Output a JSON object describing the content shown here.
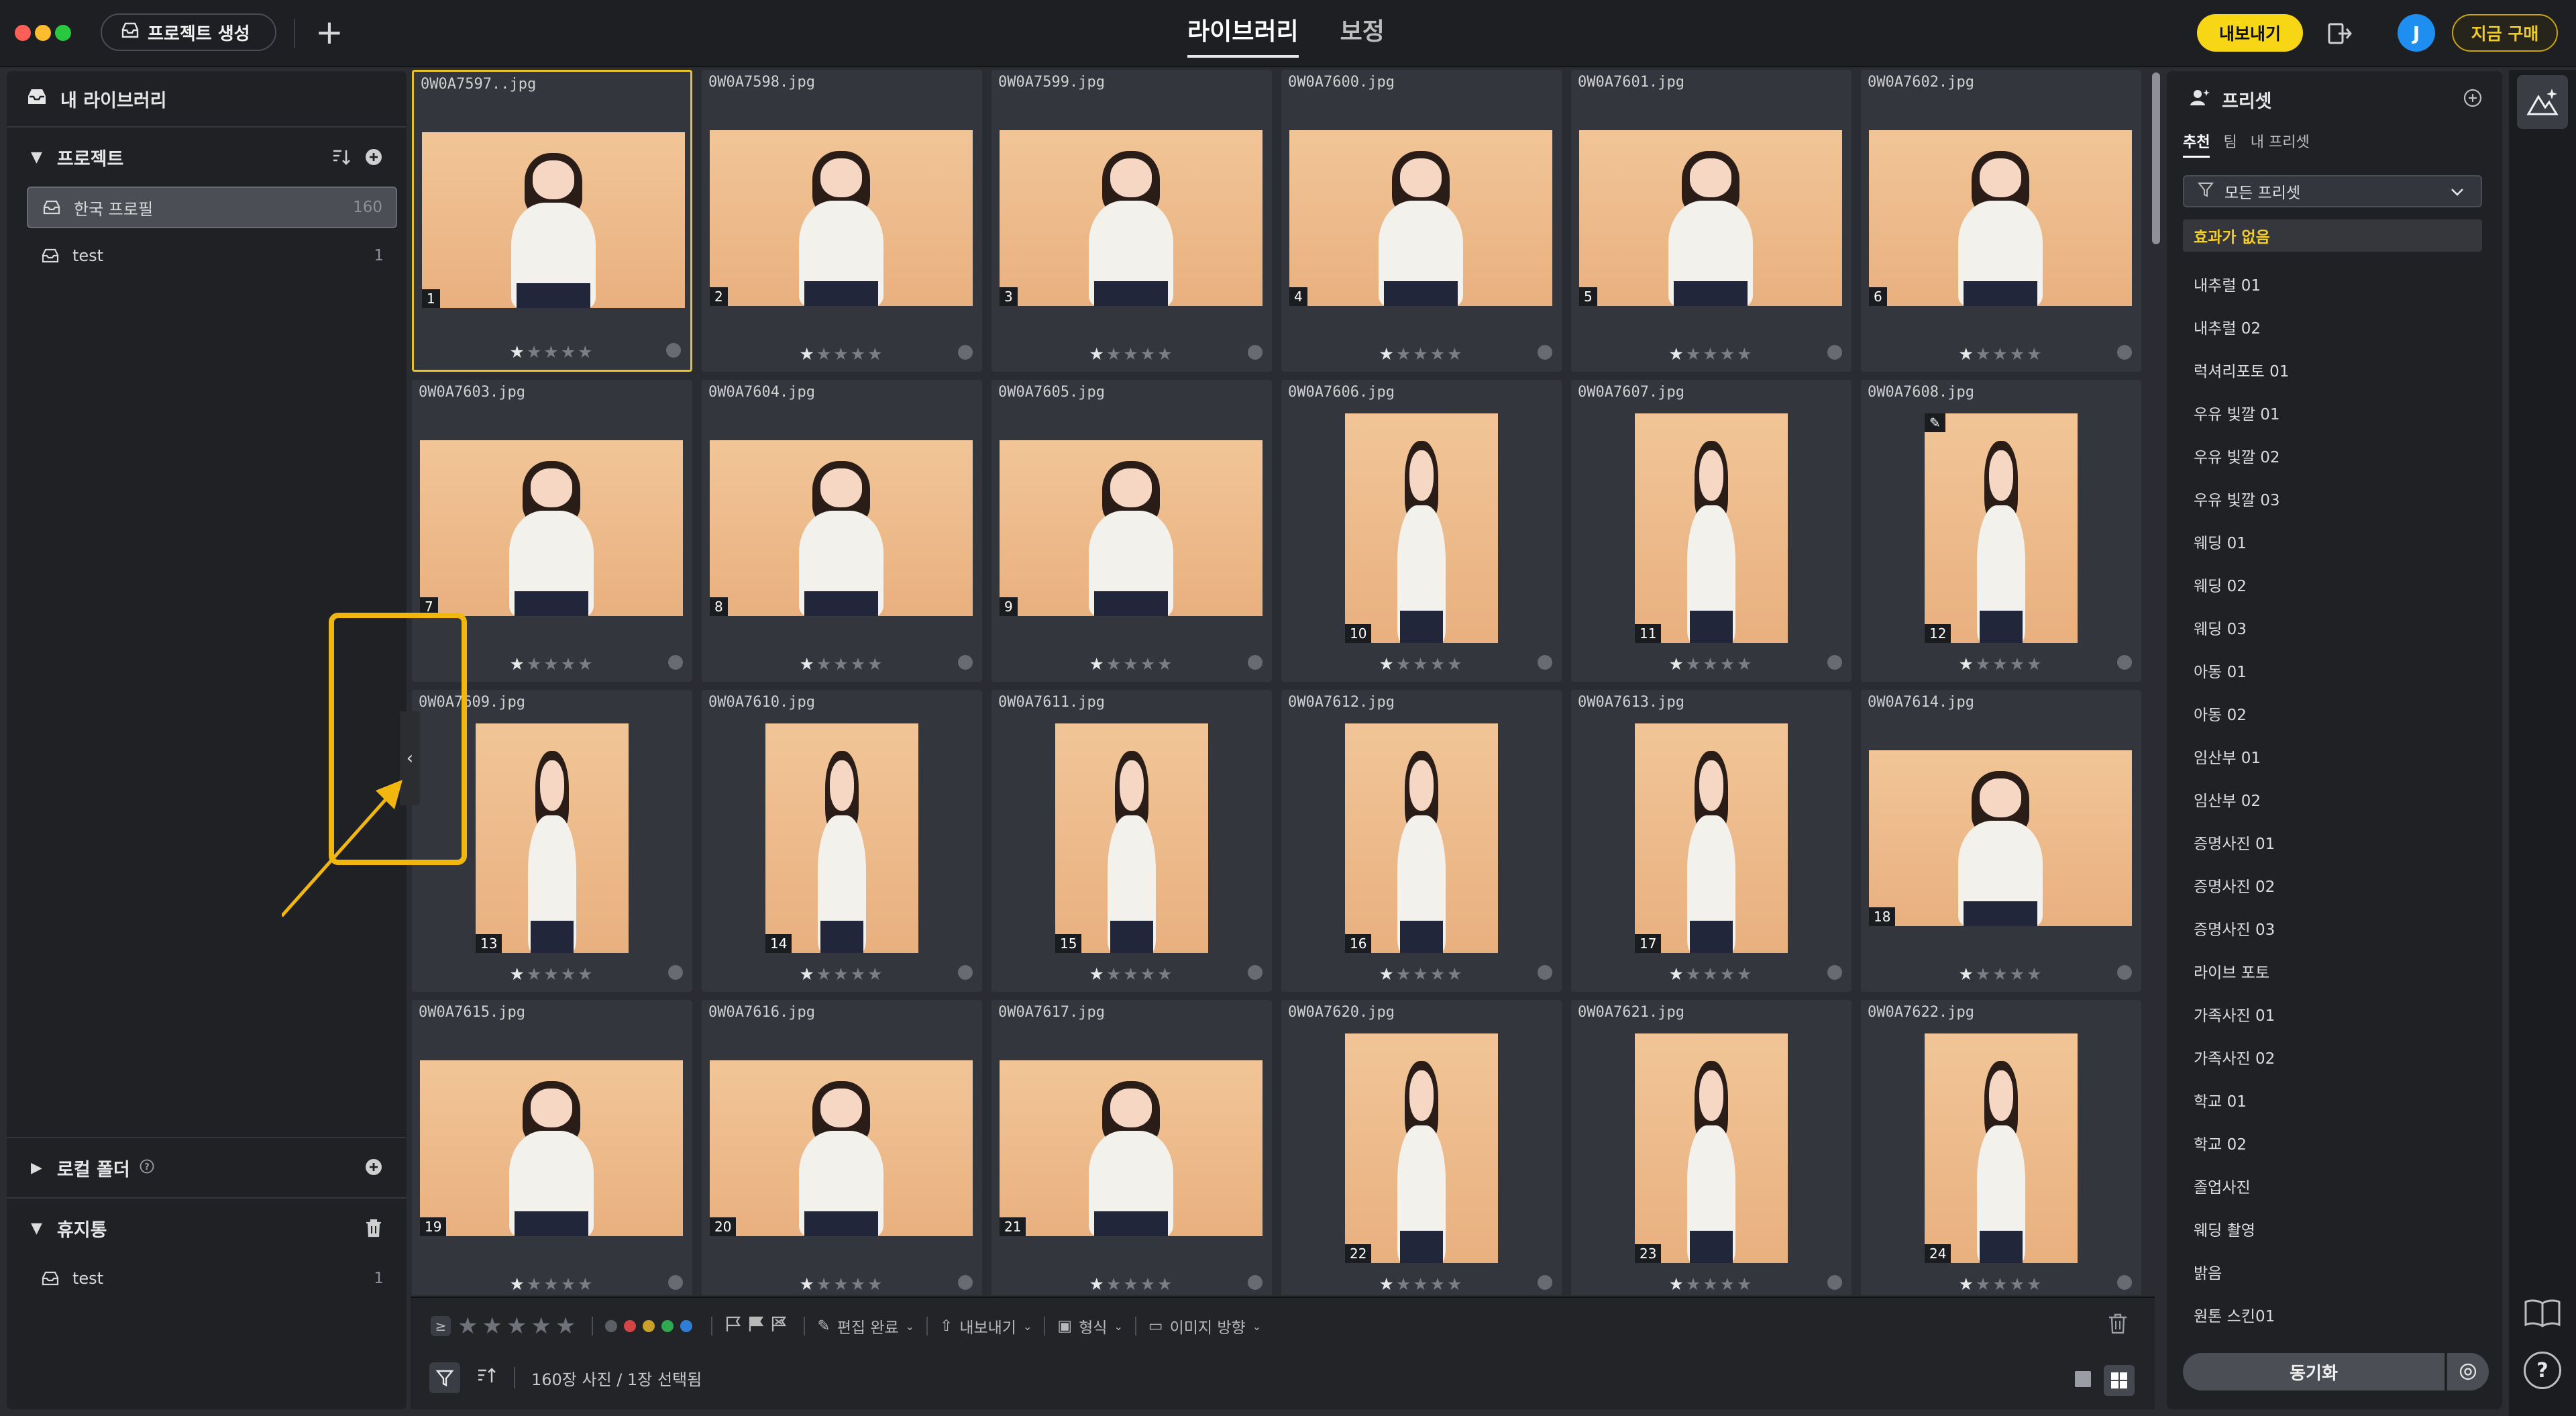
{
  "topbar": {
    "new_project_label": "프로젝트 생성",
    "tabs": [
      "라이브러리",
      "보정"
    ],
    "active_tab": "라이브러리",
    "export_label": "내보내기",
    "avatar_letter": "J",
    "buy_label": "지금 구매"
  },
  "sidebar": {
    "library_title": "내 라이브러리",
    "projects_title": "프로젝트",
    "projects": [
      {
        "name": "한국 프로필",
        "count": "160",
        "active": true
      },
      {
        "name": "test",
        "count": "1",
        "active": false
      }
    ],
    "local_folder_title": "로컬 폴더",
    "trash_title": "휴지통",
    "trash_items": [
      {
        "name": "test",
        "count": "1"
      }
    ]
  },
  "grid": {
    "photos": [
      {
        "file": "0W0A7597..jpg",
        "num": "1",
        "orient": "h",
        "rating": 1,
        "selected": true
      },
      {
        "file": "0W0A7598.jpg",
        "num": "2",
        "orient": "h",
        "rating": 1
      },
      {
        "file": "0W0A7599.jpg",
        "num": "3",
        "orient": "h",
        "rating": 1
      },
      {
        "file": "0W0A7600.jpg",
        "num": "4",
        "orient": "h",
        "rating": 1
      },
      {
        "file": "0W0A7601.jpg",
        "num": "5",
        "orient": "h",
        "rating": 1
      },
      {
        "file": "0W0A7602.jpg",
        "num": "6",
        "orient": "h",
        "rating": 1
      },
      {
        "file": "0W0A7603.jpg",
        "num": "7",
        "orient": "h",
        "rating": 1
      },
      {
        "file": "0W0A7604.jpg",
        "num": "8",
        "orient": "h",
        "rating": 1
      },
      {
        "file": "0W0A7605.jpg",
        "num": "9",
        "orient": "h",
        "rating": 1
      },
      {
        "file": "0W0A7606.jpg",
        "num": "10",
        "orient": "v",
        "rating": 1
      },
      {
        "file": "0W0A7607.jpg",
        "num": "11",
        "orient": "v",
        "rating": 1
      },
      {
        "file": "0W0A7608.jpg",
        "num": "12",
        "orient": "v",
        "rating": 1,
        "edited": true
      },
      {
        "file": "0W0A7609.jpg",
        "num": "13",
        "orient": "v",
        "rating": 1
      },
      {
        "file": "0W0A7610.jpg",
        "num": "14",
        "orient": "v",
        "rating": 1
      },
      {
        "file": "0W0A7611.jpg",
        "num": "15",
        "orient": "v",
        "rating": 1
      },
      {
        "file": "0W0A7612.jpg",
        "num": "16",
        "orient": "v",
        "rating": 1
      },
      {
        "file": "0W0A7613.jpg",
        "num": "17",
        "orient": "v",
        "rating": 1
      },
      {
        "file": "0W0A7614.jpg",
        "num": "18",
        "orient": "h",
        "rating": 1
      },
      {
        "file": "0W0A7615.jpg",
        "num": "19",
        "orient": "h",
        "rating": 1
      },
      {
        "file": "0W0A7616.jpg",
        "num": "20",
        "orient": "h",
        "rating": 1
      },
      {
        "file": "0W0A7617.jpg",
        "num": "21",
        "orient": "h",
        "rating": 1
      },
      {
        "file": "0W0A7620.jpg",
        "num": "22",
        "orient": "v",
        "rating": 1
      },
      {
        "file": "0W0A7621.jpg",
        "num": "23",
        "orient": "v",
        "rating": 1
      },
      {
        "file": "0W0A7622.jpg",
        "num": "24",
        "orient": "v",
        "rating": 1
      }
    ]
  },
  "bottombar": {
    "ge_symbol": "≥",
    "edit_done_label": "편집 완료",
    "export_label": "내보내기",
    "format_label": "형식",
    "orientation_label": "이미지 방향",
    "status_text": "160장 사진 / 1장 선택됨",
    "color_labels": [
      "#5c5f66",
      "#d64545",
      "#c9a227",
      "#2fa84f",
      "#2f7dd6"
    ]
  },
  "presets": {
    "title": "프리셋",
    "tabs": [
      "추천",
      "팀",
      "내 프리셋"
    ],
    "active_tab": "추천",
    "filter_label": "모든 프리셋",
    "items": [
      "효과가 없음",
      "내추럴 01",
      "내추럴 02",
      "럭셔리포토 01",
      "우유 빛깔 01",
      "우유 빛깔 02",
      "우유 빛깔 03",
      "웨딩 01",
      "웨딩 02",
      "웨딩 03",
      "아동 01",
      "아동 02",
      "임산부 01",
      "임산부 02",
      "증명사진 01",
      "증명사진 02",
      "증명사진 03",
      "라이브 포토",
      "가족사진 01",
      "가족사진 02",
      "학교 01",
      "학교 02",
      "졸업사진",
      "웨딩 촬영",
      "밝음",
      "원톤 스킨01"
    ],
    "active_item": "효과가 없음",
    "sync_label": "동기화"
  },
  "colors": {
    "accent": "#f7d715",
    "highlight": "#f2b70f",
    "avatar": "#1e8ff0"
  }
}
